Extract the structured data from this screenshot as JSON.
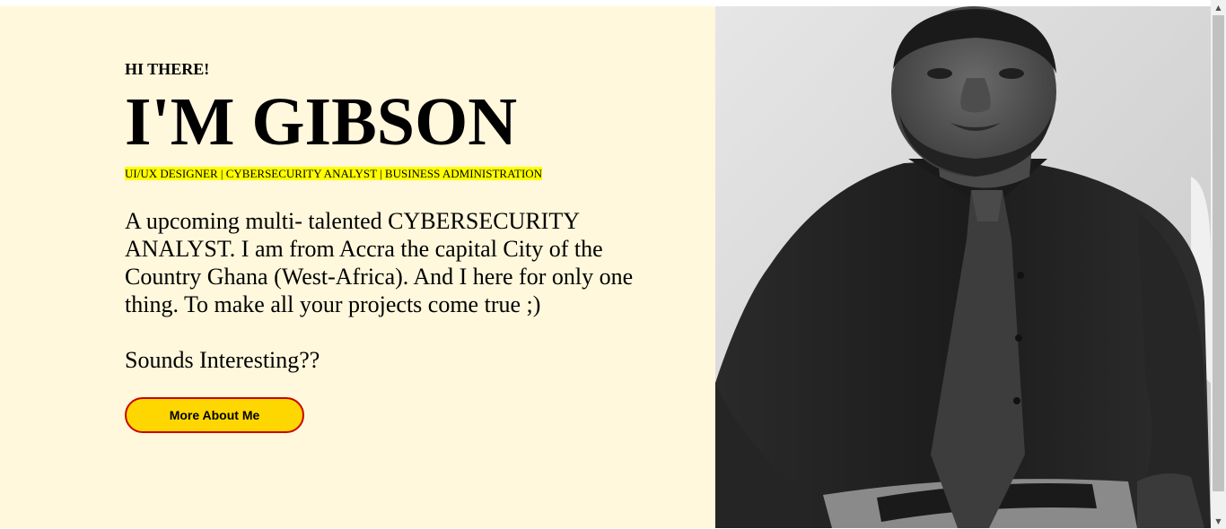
{
  "hero": {
    "greeting": "HI THERE!",
    "name": "I'M GIBSON",
    "roles": "UI/UX DESIGNER | CYBERSECURITY ANALYST | BUSINESS ADMINISTRATION",
    "bio": "A upcoming multi- talented CYBERSECURITY ANALYST. I am from Accra the capital City of the Country Ghana (West-Africa). And I here for only one thing. To make all your projects come true ;)",
    "question": "Sounds Interesting??",
    "button_label": "More About Me"
  },
  "colors": {
    "background": "#fff8dc",
    "highlight": "#ffff00",
    "button_fill": "#ffd700",
    "button_border": "#cc0000"
  },
  "scrollbar": {
    "up_icon": "triangle-up",
    "down_icon": "triangle-down"
  }
}
